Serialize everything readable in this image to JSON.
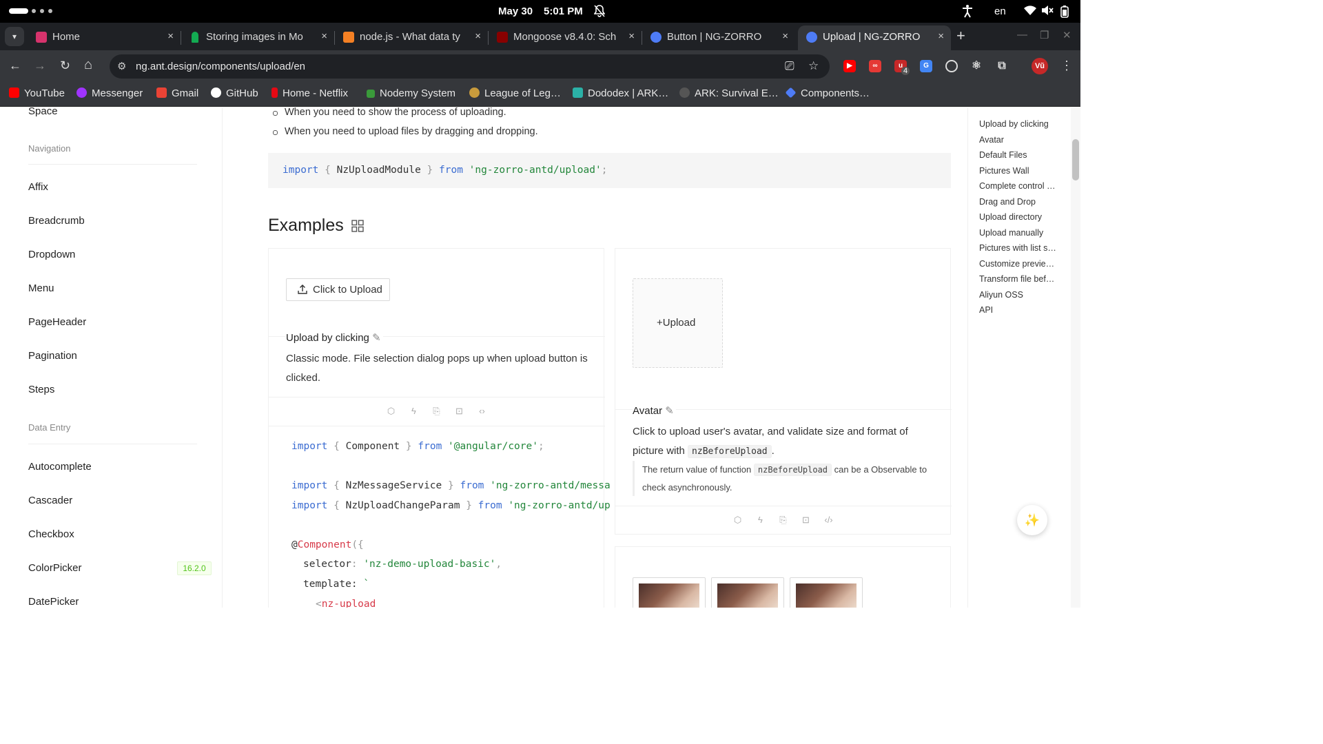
{
  "os": {
    "date": "May 30",
    "time": "5:01 PM",
    "language": "en"
  },
  "tabs": [
    {
      "title": "Home",
      "color": "#d6336c",
      "close": "×"
    },
    {
      "title": "Storing images in Mo",
      "color": "#13aa52",
      "close": "×"
    },
    {
      "title": "node.js - What data ty",
      "color": "#f48024",
      "close": "×"
    },
    {
      "title": "Mongoose v8.4.0: Sch",
      "color": "#880000",
      "close": "×"
    },
    {
      "title": "Button | NG-ZORRO",
      "color": "#4e7cf6",
      "close": "×"
    },
    {
      "title": "Upload | NG-ZORRO",
      "color": "#4e7cf6",
      "close": "×",
      "active": true
    }
  ],
  "address": {
    "url": "ng.ant.design/components/upload/en"
  },
  "bookmarks": [
    {
      "label": "YouTube",
      "color": "#ff0000"
    },
    {
      "label": "Messenger",
      "color": "#a033ff"
    },
    {
      "label": "Gmail",
      "color": "#ea4335"
    },
    {
      "label": "GitHub",
      "color": "#ffffff"
    },
    {
      "label": "Home - Netflix",
      "color": "#e50914"
    },
    {
      "label": "Nodemy System",
      "color": "#3a9a3a"
    },
    {
      "label": "League of Leg…",
      "color": "#c89b3c"
    },
    {
      "label": "Dododex | ARK…",
      "color": "#2bb1a7"
    },
    {
      "label": "ARK: Survival E…",
      "color": "#555555"
    },
    {
      "label": "Components…",
      "color": "#4e7cf6"
    }
  ],
  "extensions": {
    "badge_count": "4",
    "profile": "Vũ"
  },
  "sidebar": {
    "partial_top": "Space",
    "group_navigation": "Navigation",
    "nav_items": [
      "Affix",
      "Breadcrumb",
      "Dropdown",
      "Menu",
      "PageHeader",
      "Pagination",
      "Steps"
    ],
    "group_data_entry": "Data Entry",
    "entry_items": [
      "Autocomplete",
      "Cascader",
      "Checkbox",
      "ColorPicker",
      "DatePicker"
    ],
    "colorpicker_badge": "16.2.0"
  },
  "content": {
    "bullets": [
      "When you need to show the process of uploading.",
      "When you need to upload files by dragging and dropping."
    ],
    "import_line": {
      "kw1": "import",
      "lb": "{",
      "name": "NzUploadModule",
      "rb": "}",
      "kw2": "from",
      "module": "'ng-zorro-antd/upload'",
      "semi": ";"
    },
    "examples_title": "Examples",
    "example1": {
      "button_label": "Click to Upload",
      "title": "Upload by clicking",
      "desc": "Classic mode. File selection dialog pops up when upload button is clicked.",
      "code": [
        {
          "kw": "import",
          "lb": "{",
          "name": "Component",
          "rb": "}",
          "from": "from",
          "mod": "'@angular/core'",
          "semi": ";"
        },
        {
          "kw": "import",
          "lb": "{",
          "name": "NzMessageService",
          "rb": "}",
          "from": "from",
          "mod": "'ng-zorro-antd/messa"
        },
        {
          "kw": "import",
          "lb": "{",
          "name": "NzUploadChangeParam",
          "rb": "}",
          "from": "from",
          "mod": "'ng-zorro-antd/up"
        }
      ],
      "decorator_at": "@",
      "decorator": "Component",
      "decorator_open": "({",
      "selector_key": "selector",
      "selector_colon": ":",
      "selector_val": "'nz-demo-upload-basic'",
      "selector_comma": ",",
      "template_key": "template:",
      "template_tick": "`",
      "tag_lt": "<",
      "tag": "nz-upload"
    },
    "example2": {
      "upload_label": "Upload",
      "title": "Avatar",
      "desc_pre": "Click to upload user's avatar, and validate size and format of picture with",
      "desc_code": "nzBeforeUpload",
      "desc_post": ".",
      "quote_pre": "The return value of function",
      "quote_code": "nzBeforeUpload",
      "quote_post": "can be a Observable to check asynchronously."
    }
  },
  "toc": [
    "Upload by clicking",
    "Avatar",
    "Default Files",
    "Pictures Wall",
    "Complete control …",
    "Drag and Drop",
    "Upload directory",
    "Upload manually",
    "Pictures with list s…",
    "Customize previe…",
    "Transform file bef…",
    "Aliyun OSS",
    "API"
  ],
  "icons": {
    "edit": "✎",
    "plus": "+",
    "back": "←",
    "forward": "→",
    "reload": "↻",
    "home": "⌂",
    "star": "☆",
    "more": "⋮"
  }
}
